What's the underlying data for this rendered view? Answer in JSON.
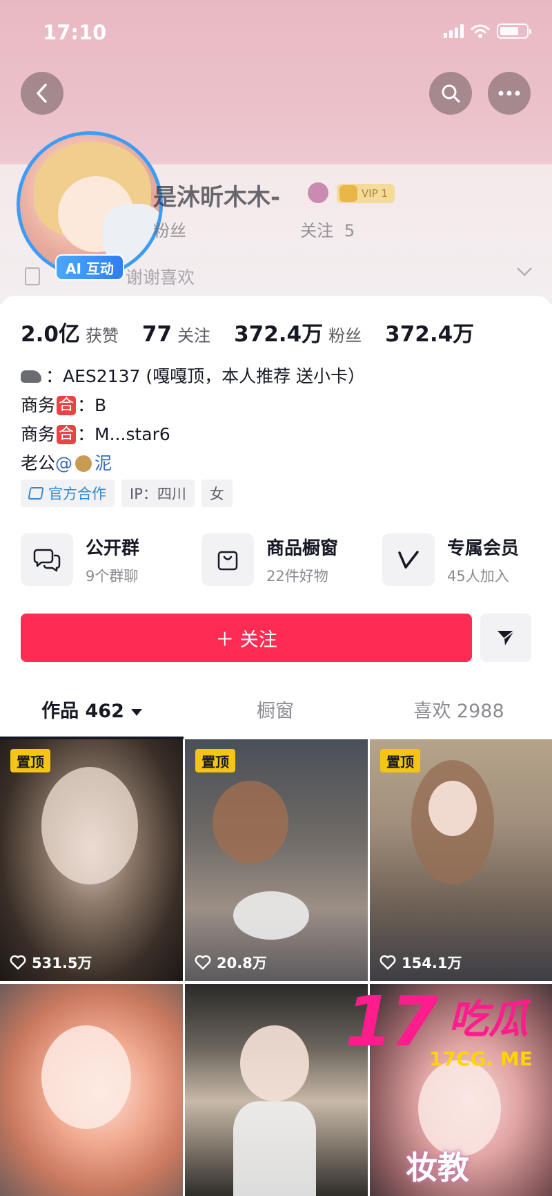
{
  "status_bar": {
    "time": "17:10"
  },
  "profile": {
    "nickname": "是沐昕木木-",
    "vip_label": "VIP 1",
    "sub_line_prefix": "粉丝",
    "sub_line_follow": "关注",
    "sub_line_follow_count": "5",
    "signature": "谢谢喜欢",
    "ai_badge": "AI 互动"
  },
  "stats": [
    {
      "value": "2.0亿",
      "label": "获赞"
    },
    {
      "value": "77",
      "label": "关注"
    },
    {
      "value": "372.4万",
      "label": "粉丝"
    },
    {
      "value": "372.4万",
      "label": ""
    }
  ],
  "bio": {
    "line1": "：AES2137 (嘎嘎顶，本人推荐 送小卡）",
    "line2_prefix": "商务",
    "line2_badge": "合",
    "line2_value": "：B",
    "line3_prefix": "商务",
    "line3_badge": "合",
    "line3_value": "：M...star6",
    "line4_prefix": "老公",
    "line4_link": "@",
    "line4_suffix": "泥"
  },
  "tags": [
    "官方合作",
    "IP：四川",
    "女"
  ],
  "features": [
    {
      "title": "公开群",
      "subtitle": "9个群聊",
      "icon": "chat-bubbles-icon"
    },
    {
      "title": "商品橱窗",
      "subtitle": "22件好物",
      "icon": "shopping-bag-icon"
    },
    {
      "title": "专属会员",
      "subtitle": "45人加入",
      "icon": "v-member-icon"
    }
  ],
  "follow_button": "＋ 关注",
  "tabs": [
    {
      "label": "作品 462",
      "active": true
    },
    {
      "label": "橱窗",
      "active": false
    },
    {
      "label": "喜欢 2988",
      "active": false
    }
  ],
  "videos": [
    {
      "pinned": "置顶",
      "likes": "531.5万"
    },
    {
      "pinned": "置顶",
      "likes": "20.8万"
    },
    {
      "pinned": "置顶",
      "likes": "154.1万"
    },
    {
      "pinned": "",
      "likes": ""
    },
    {
      "pinned": "",
      "likes": ""
    },
    {
      "pinned": "",
      "likes": ""
    }
  ],
  "watermark": {
    "number": "17",
    "text": "吃瓜",
    "url": "17CG. ME"
  },
  "video6_overlay": "妆教",
  "colors": {
    "accent": "#fe2c55",
    "link": "#3b6ab8",
    "pin": "#f5c516",
    "watermark": "#ff1c8d"
  }
}
